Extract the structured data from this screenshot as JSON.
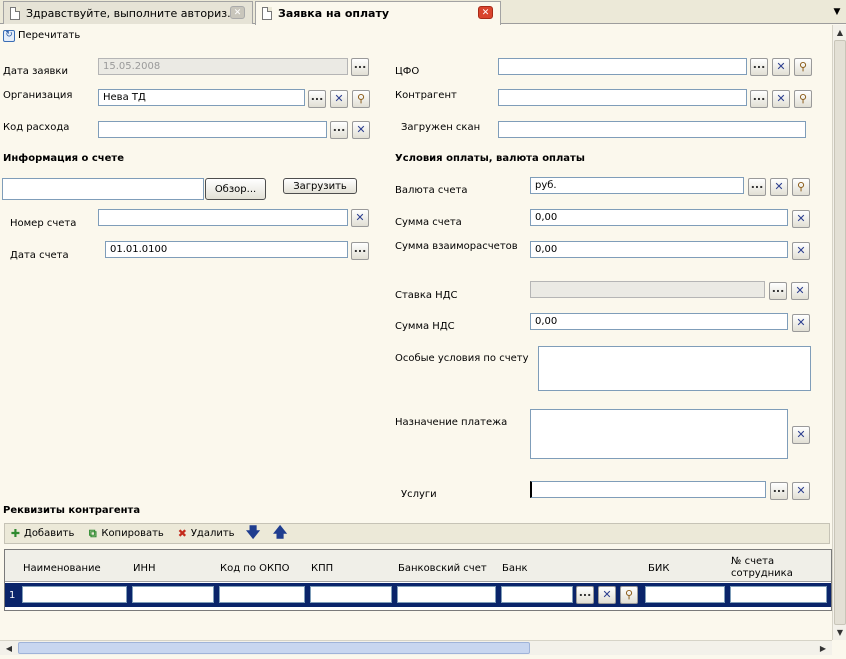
{
  "tabs": [
    {
      "title": "Здравствуйте, выполните авториз..."
    },
    {
      "title": "Заявка на оплату"
    }
  ],
  "toolbar": {
    "refresh_label": "Перечитать"
  },
  "left": {
    "date_label": "Дата заявки",
    "date_value": "15.05.2008",
    "org_label": "Организация",
    "org_value": "Нева ТД",
    "expense_label": "Код расхода",
    "expense_value": "",
    "invoice_section": "Информация о счете",
    "browse_label": "Обзор...",
    "upload_label": "Загрузить",
    "file_value": "",
    "inv_number_label": "Номер счета",
    "inv_number_value": "",
    "inv_date_label": "Дата счета",
    "inv_date_value": "01.01.0100"
  },
  "right": {
    "cfo_label": "ЦФО",
    "cfo_value": "",
    "contractor_label": "Контрагент",
    "contractor_value": "",
    "scan_label": "Загружен скан",
    "scan_value": "",
    "terms_section": "Условия оплаты, валюта оплаты",
    "currency_label": "Валюта счета",
    "currency_value": "руб.",
    "amount_label": "Сумма счета",
    "amount_value": "0,00",
    "settle_label": "Сумма взаиморасчетов",
    "settle_value": "0,00",
    "vat_rate_label": "Ставка НДС",
    "vat_rate_value": "",
    "vat_amount_label": "Сумма НДС",
    "vat_amount_value": "0,00",
    "special_label": "Особые условия по счету",
    "purpose_label": "Назначение платежа",
    "services_label": "Услуги",
    "services_value": ""
  },
  "requisites": {
    "section": "Реквизиты контрагента",
    "add_label": "Добавить",
    "copy_label": "Копировать",
    "delete_label": "Удалить",
    "columns": [
      "Наименование",
      "ИНН",
      "Код по ОКПО",
      "КПП",
      "Банковский счет",
      "Банк",
      "БИК",
      "№ счета сотрудника"
    ],
    "row_number": "1"
  },
  "colors": {
    "background": "#fbf8ed",
    "selected_row": "#0a246a",
    "input_border": "#7f9db9"
  },
  "icons": [
    "document-icon",
    "close-icon",
    "refresh-icon",
    "ellipsis-icon",
    "clear-icon",
    "search-icon",
    "add-icon",
    "copy-icon",
    "delete-icon",
    "arrow-down-icon",
    "arrow-up-icon"
  ]
}
